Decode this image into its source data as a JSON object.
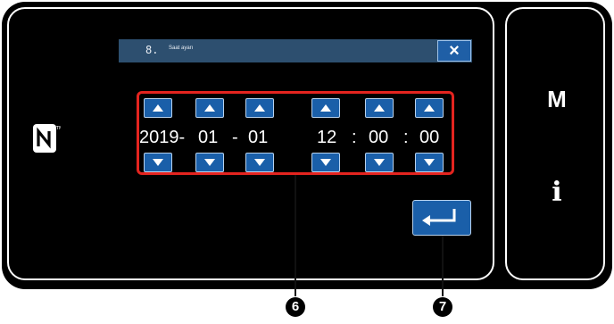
{
  "dialog": {
    "number": "8.",
    "title": "Saat ayarı",
    "close_label": "×"
  },
  "datetime": {
    "year": "2019-",
    "month": "01",
    "sep1": "-",
    "day": "01",
    "hour": "12",
    "colon1": ":",
    "minute": "00",
    "colon2": ":",
    "second": "00"
  },
  "side": {
    "mode_label": "M",
    "info_label": "i"
  },
  "callouts": {
    "c6": "6",
    "c7": "7"
  },
  "colors": {
    "accent": "#1a5fa9",
    "titlebar": "#2d4f6f",
    "highlight": "#e4241f"
  },
  "icons": [
    "nfc-icon",
    "close-icon",
    "arrow-up-icon",
    "arrow-down-icon",
    "enter-icon"
  ]
}
